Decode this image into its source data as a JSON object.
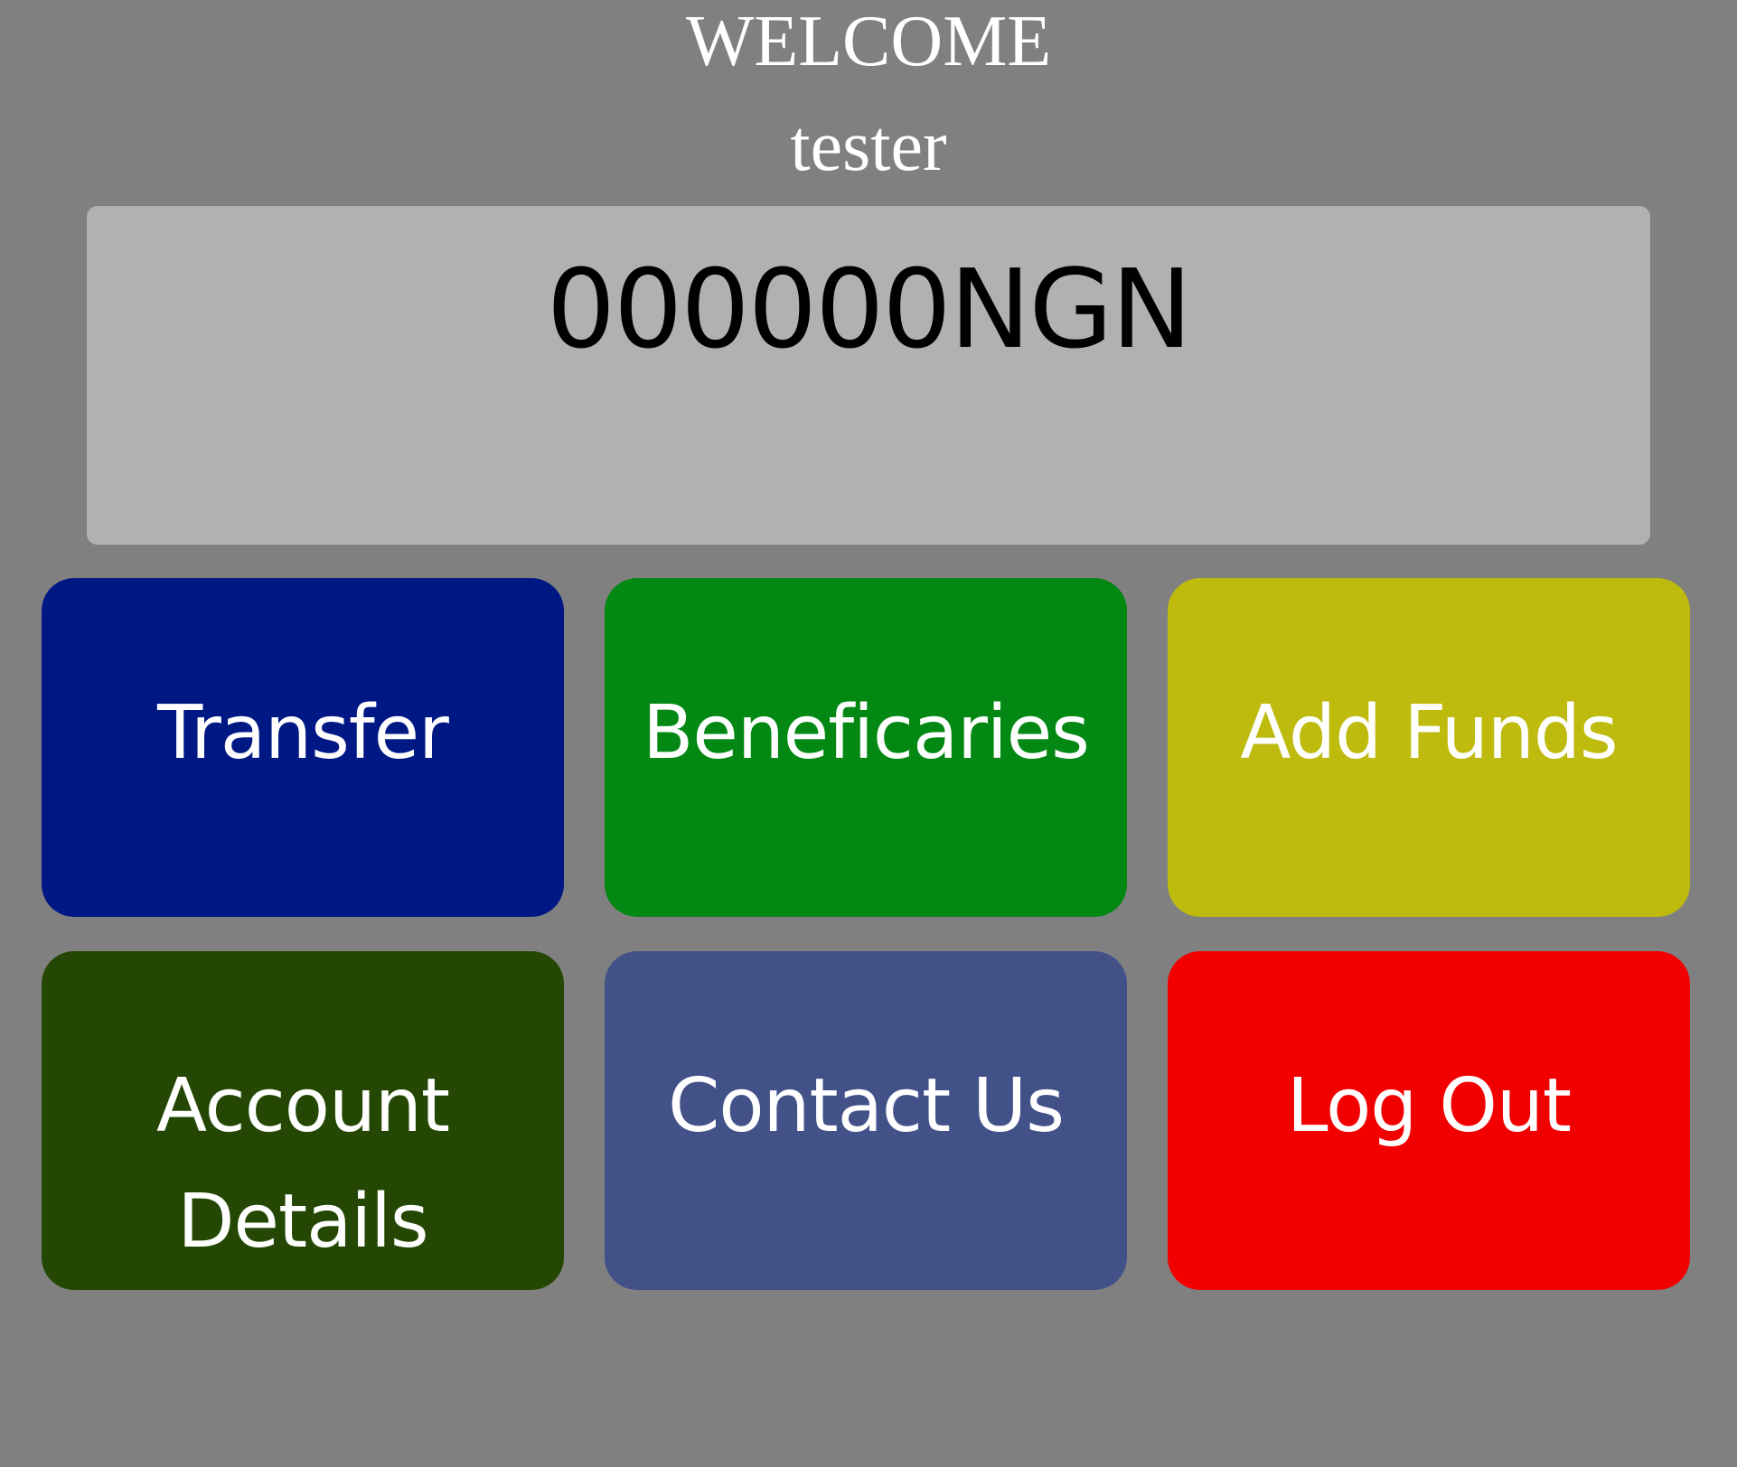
{
  "header": {
    "welcome": "WELCOME",
    "username": "tester"
  },
  "account": {
    "balance": "000000NGN"
  },
  "menu": {
    "transfer_label": "Transfer",
    "beneficiaries_label": "Beneficaries",
    "add_funds_label": "Add Funds",
    "account_details_label": "Account Details",
    "contact_us_label": "Contact Us",
    "log_out_label": "Log Out"
  },
  "colors": {
    "background": "#808080",
    "balance_card": "#b2b0b1",
    "transfer": "#001884",
    "beneficiaries": "#028813",
    "add_funds": "#bebb0e",
    "account_details": "#244803",
    "contact_us": "#435189",
    "log_out": "#f20000"
  }
}
